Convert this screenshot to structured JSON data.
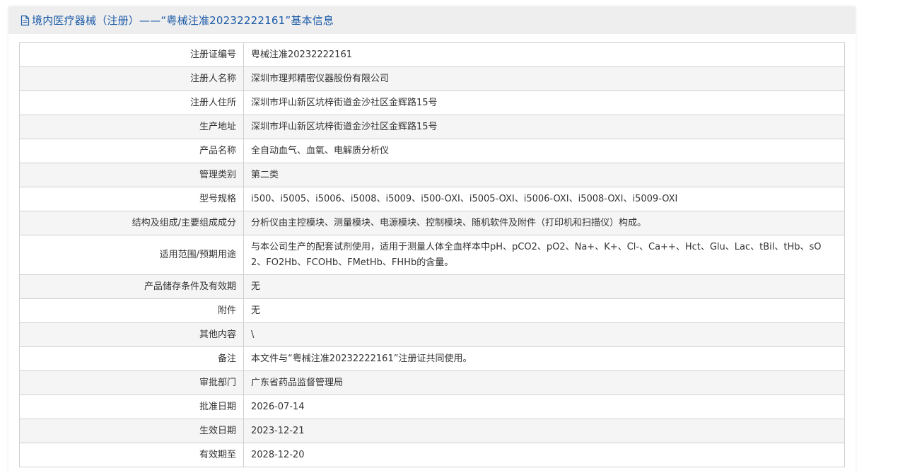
{
  "header": {
    "title": "境内医疗器械（注册）——“粤械注准20232222161”基本信息",
    "icon": "document-icon",
    "color": "#1a5aa8"
  },
  "rows": [
    {
      "label": "注册证编号",
      "value": "粤械注准20232222161"
    },
    {
      "label": "注册人名称",
      "value": "深圳市理邦精密仪器股份有限公司"
    },
    {
      "label": "注册人住所",
      "value": "深圳市坪山新区坑梓街道金沙社区金辉路15号"
    },
    {
      "label": "生产地址",
      "value": "深圳市坪山新区坑梓街道金沙社区金辉路15号"
    },
    {
      "label": "产品名称",
      "value": "全自动血气、血氧、电解质分析仪"
    },
    {
      "label": "管理类别",
      "value": "第二类"
    },
    {
      "label": "型号规格",
      "value": "i500、i5005、i5006、i5008、i5009、i500-OXI、i5005-OXI、i5006-OXI、i5008-OXI、i5009-OXI"
    },
    {
      "label": "结构及组成/主要组成成分",
      "value": "分析仪由主控模块、测量模块、电源模块、控制模块、随机软件及附件（打印机和扫描仪）构成。"
    },
    {
      "label": "适用范围/预期用途",
      "value": "与本公司生产的配套试剂使用，适用于测量人体全血样本中pH、pCO2、pO2、Na+、K+、Cl-、Ca++、Hct、Glu、Lac、tBil、tHb、sO2、FO2Hb、FCOHb、FMetHb、FHHb的含量。"
    },
    {
      "label": "产品储存条件及有效期",
      "value": "无"
    },
    {
      "label": "附件",
      "value": "无"
    },
    {
      "label": "其他内容",
      "value": "\\"
    },
    {
      "label": "备注",
      "value": "本文件与“粤械注准20232222161”注册证共同使用。"
    },
    {
      "label": "审批部门",
      "value": "广东省药品监督管理局"
    },
    {
      "label": "批准日期",
      "value": "2026-07-14"
    },
    {
      "label": "生效日期",
      "value": "2023-12-21"
    },
    {
      "label": "有效期至",
      "value": "2028-12-20"
    }
  ]
}
